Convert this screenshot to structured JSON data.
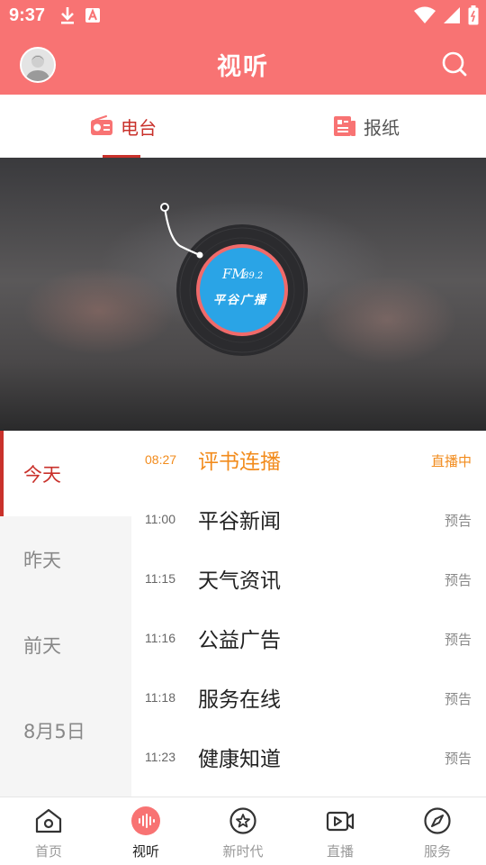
{
  "status_bar": {
    "time": "9:37",
    "icons": [
      "download-icon",
      "a-icon",
      "wifi-icon",
      "signal-icon",
      "battery-icon"
    ]
  },
  "header": {
    "title": "视听",
    "avatar_icon": "user-avatar-icon",
    "search_icon": "search-icon"
  },
  "top_tabs": [
    {
      "label": "电台",
      "icon": "radio-icon",
      "active": true
    },
    {
      "label": "报纸",
      "icon": "newspaper-icon",
      "active": false
    }
  ],
  "banner": {
    "station_line1": "FM",
    "station_freq": "89.2",
    "station_name": "平谷广播"
  },
  "days": [
    {
      "label": "今天",
      "active": true
    },
    {
      "label": "昨天",
      "active": false
    },
    {
      "label": "前天",
      "active": false
    },
    {
      "label": "8月5日",
      "active": false
    }
  ],
  "programs": [
    {
      "time": "08:27",
      "name": "评书连播",
      "status": "直播中",
      "live": true
    },
    {
      "time": "11:00",
      "name": "平谷新闻",
      "status": "预告",
      "live": false
    },
    {
      "time": "11:15",
      "name": "天气资讯",
      "status": "预告",
      "live": false
    },
    {
      "time": "11:16",
      "name": "公益广告",
      "status": "预告",
      "live": false
    },
    {
      "time": "11:18",
      "name": "服务在线",
      "status": "预告",
      "live": false
    },
    {
      "time": "11:23",
      "name": "健康知道",
      "status": "预告",
      "live": false
    }
  ],
  "bottom_nav": [
    {
      "label": "首页",
      "icon": "home-icon",
      "active": false
    },
    {
      "label": "视听",
      "icon": "audio-wave-icon",
      "active": true
    },
    {
      "label": "新时代",
      "icon": "star-circle-icon",
      "active": false
    },
    {
      "label": "直播",
      "icon": "video-camera-icon",
      "active": false
    },
    {
      "label": "服务",
      "icon": "compass-icon",
      "active": false
    }
  ],
  "colors": {
    "brand": "#f87373",
    "accent": "#c9312b",
    "live": "#f28b1c",
    "record_label": "#2aa4e6"
  }
}
